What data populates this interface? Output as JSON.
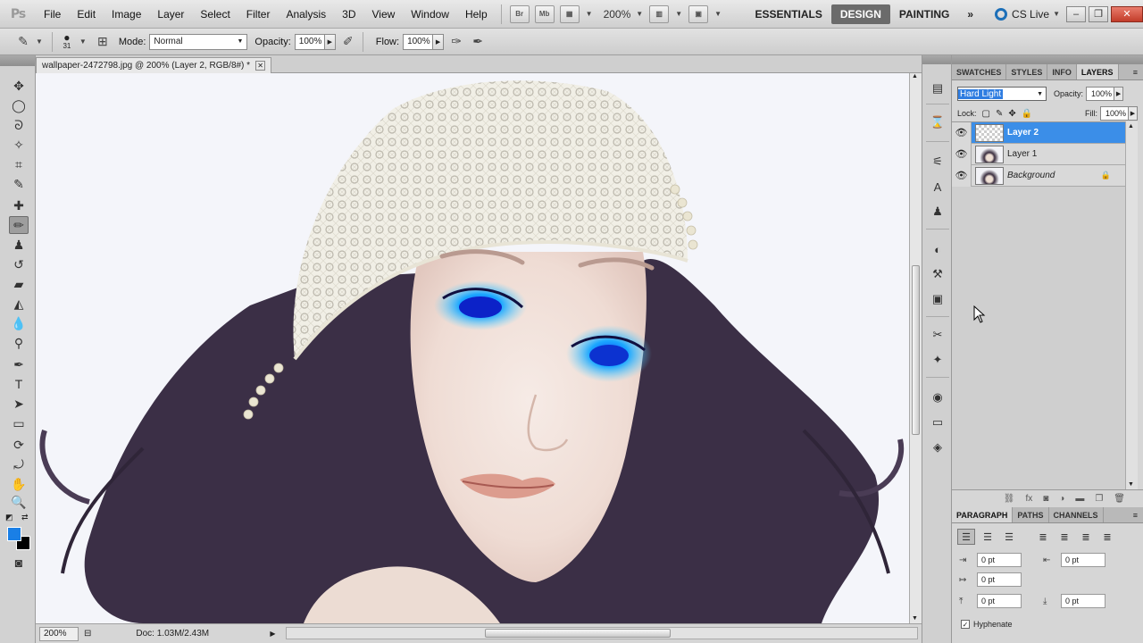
{
  "app": {
    "logo": "Ps"
  },
  "menu": {
    "items": [
      "File",
      "Edit",
      "Image",
      "Layer",
      "Select",
      "Filter",
      "Analysis",
      "3D",
      "View",
      "Window",
      "Help"
    ],
    "bridge_label": "Br",
    "minibridge_label": "Mb",
    "zoom": "200%",
    "workspaces": [
      "ESSENTIALS",
      "DESIGN",
      "PAINTING"
    ],
    "active_workspace": "DESIGN",
    "more": "»",
    "cslive": "CS Live",
    "win_minimize": "–",
    "win_restore": "❐",
    "win_close": "✕"
  },
  "options": {
    "brush_size": "31",
    "mode_label": "Mode:",
    "mode_value": "Normal",
    "opacity_label": "Opacity:",
    "opacity_value": "100%",
    "flow_label": "Flow:",
    "flow_value": "100%"
  },
  "document": {
    "tab_title": "wallpaper-2472798.jpg @ 200% (Layer 2, RGB/8#) *",
    "tab_close": "✕",
    "status_zoom": "200%",
    "status_doc": "Doc: 1.03M/2.43M"
  },
  "panels": {
    "top_tabs": [
      "SWATCHES",
      "STYLES",
      "INFO",
      "LAYERS"
    ],
    "active_top_tab": "LAYERS",
    "blend_mode": "Hard Light",
    "opacity_label": "Opacity:",
    "opacity_value": "100%",
    "lock_label": "Lock:",
    "fill_label": "Fill:",
    "fill_value": "100%",
    "layers": [
      {
        "name": "Layer 2",
        "selected": true,
        "thumb": "transparent",
        "italic": false
      },
      {
        "name": "Layer 1",
        "selected": false,
        "thumb": "photo",
        "italic": false
      },
      {
        "name": "Background",
        "selected": false,
        "thumb": "photo",
        "italic": true,
        "locked": true
      }
    ],
    "bottom_tabs": [
      "PARAGRAPH",
      "PATHS",
      "CHANNELS"
    ],
    "active_bottom_tab": "PARAGRAPH",
    "indent_left": "0 pt",
    "indent_right": "0 pt",
    "indent_first": "0 pt",
    "space_before": "0 pt",
    "space_after": "0 pt",
    "hyphenate_label": "Hyphenate",
    "hyphenate_checked": true
  },
  "colors": {
    "foreground": "#1a7fe6",
    "background": "#000000",
    "selection": "#3b8ee8"
  }
}
